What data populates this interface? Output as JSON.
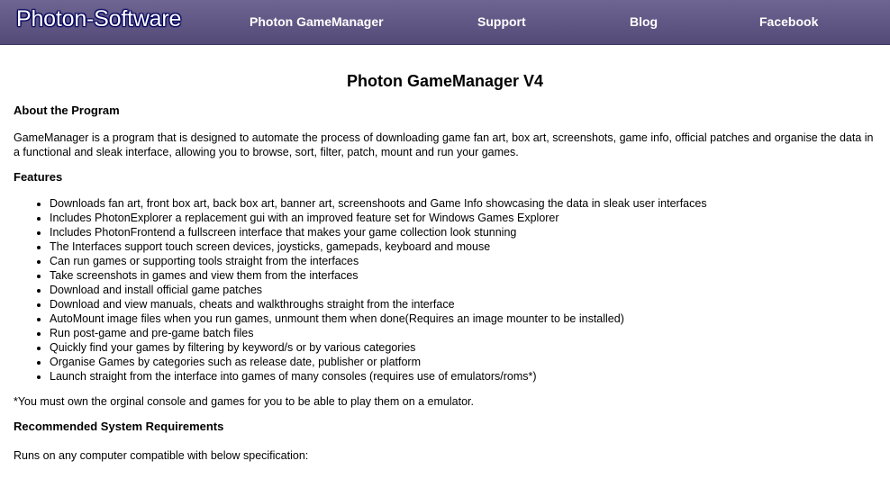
{
  "nav": {
    "logo": "Photon-Software",
    "links": [
      "Photon GameManager",
      "Support",
      "Blog",
      "Facebook"
    ]
  },
  "page": {
    "title": "Photon GameManager V4",
    "about_heading": "About the Program",
    "about_text": "GameManager is a program that is designed to automate the process of downloading game fan art, box art, screenshots, game info, official patches and organise the data in a functional and sleak interface, allowing you to browse, sort, filter, patch, mount and run your games.",
    "features_heading": "Features",
    "features": [
      "Downloads fan art, front box art, back box art, banner art, screenshoots and Game Info showcasing the data in sleak user interfaces",
      "Includes PhotonExplorer a replacement gui with an improved feature set for Windows Games Explorer",
      "Includes PhotonFrontend a fullscreen interface that makes your game collection look stunning",
      "The Interfaces support touch screen devices, joysticks, gamepads, keyboard and mouse",
      "Can run games or supporting tools straight from the interfaces",
      "Take screenshots in games and view them from the interfaces",
      "Download and install official game patches",
      "Download and view manuals, cheats and walkthroughs straight from the interface",
      "AutoMount image files when you run games, unmount them when done(Requires an image mounter to be installed)",
      "Run post-game and pre-game batch files",
      "Quickly find your games by filtering by keyword/s or by various categories",
      "Organise Games by categories such as release date, publisher or platform",
      "Launch straight from the interface into games of many consoles (requires use of emulators/roms*)"
    ],
    "footnote": "*You must own the orginal console and games for you to be able to play them on a emulator.",
    "requirements_heading": "Recommended System Requirements",
    "requirements_text": "Runs on any computer compatible with below specification:"
  }
}
